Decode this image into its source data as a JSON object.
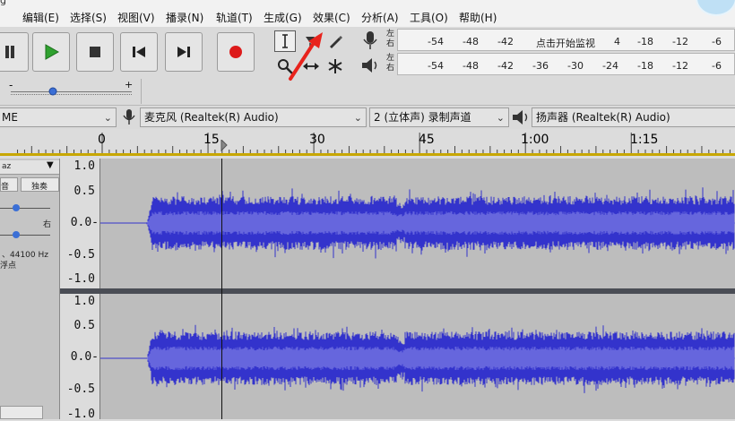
{
  "window": {
    "title_fragment": "g"
  },
  "menu": [
    "编辑(E)",
    "选择(S)",
    "视图(V)",
    "播录(N)",
    "轨道(T)",
    "生成(G)",
    "效果(C)",
    "分析(A)",
    "工具(O)",
    "帮助(H)"
  ],
  "transport": {
    "pause": "pause-icon",
    "play": "play-icon",
    "stop": "stop-icon",
    "skip_start": "skip-start-icon",
    "skip_end": "skip-end-icon",
    "record": "record-icon"
  },
  "tools": [
    "selection-tool",
    "envelope-tool",
    "draw-tool",
    "zoom-tool",
    "timeshift-tool",
    "multi-tool"
  ],
  "meters": {
    "record": {
      "left": "左",
      "right": "右",
      "ticks": [
        "-54",
        "-48",
        "-42",
        "点击开始监视",
        "4",
        "-18",
        "-12",
        "-6"
      ]
    },
    "playback": {
      "left": "左",
      "right": "右",
      "ticks": [
        "-54",
        "-48",
        "-42",
        "-36",
        "-30",
        "-24",
        "-18",
        "-12",
        "-6"
      ]
    }
  },
  "playback_slider": {
    "minus": "-",
    "plus": "+",
    "level": 0.35
  },
  "devices": {
    "host": "ME",
    "mic": "麦克风 (Realtek(R) Audio)",
    "channels": "2 (立体声) 录制声道",
    "speaker": "扬声器 (Realtek(R) Audio)"
  },
  "timeline": {
    "labels": [
      "0",
      "15",
      "30",
      "45",
      "1:00",
      "1:15"
    ]
  },
  "track": {
    "name_fragment": "az",
    "mute_fragment": "音",
    "solo": "独奏",
    "pan_right": "右",
    "info_line1": "、44100 Hz",
    "info_line2": "浮点",
    "scale": [
      "1.0",
      "0.5",
      "0.0-",
      "-0.5",
      "-1.0"
    ]
  },
  "colors": {
    "wave_dark": "#3333cc",
    "wave_light": "#6666dd",
    "wave_bg": "#bdbdbd",
    "timeline_bar": "#c8a700"
  }
}
